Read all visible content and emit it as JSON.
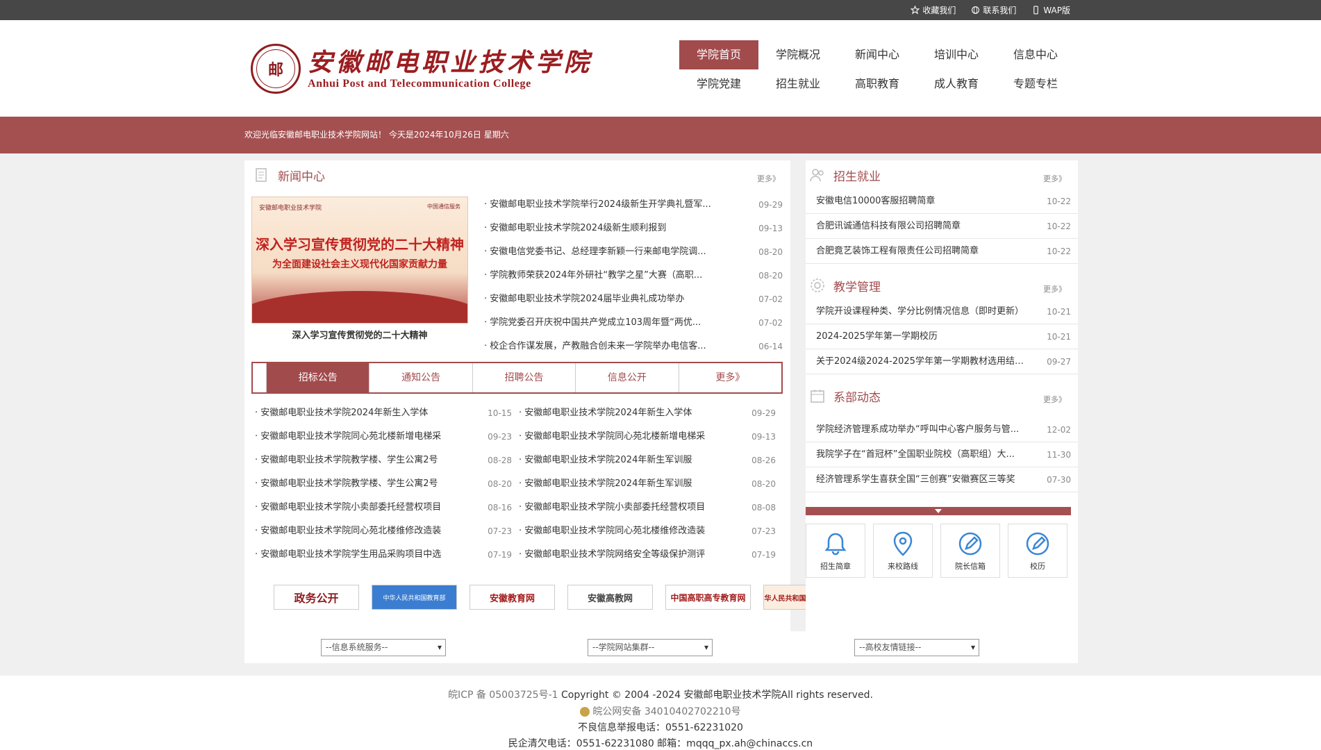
{
  "topbar": {
    "favorite": "收藏我们",
    "contact": "联系我们",
    "wap": "WAP版"
  },
  "header": {
    "logo_seal": "邮",
    "logo_cn": "安徽邮电职业技术学院",
    "logo_en": "Anhui Post and Telecommunication College"
  },
  "nav": {
    "row1": [
      "学院首页",
      "学院概况",
      "新闻中心",
      "培训中心",
      "信息中心"
    ],
    "row2": [
      "学院党建",
      "招生就业",
      "高职教育",
      "成人教育",
      "专题专栏"
    ]
  },
  "welcome": "欢迎光临安徽邮电职业技术学院网站！ 今天是2024年10月26日 星期六",
  "news": {
    "title": "新闻中心",
    "more": "更多》",
    "feature": {
      "img_top_left": "安徽邮电职业技术学院",
      "img_top_right": "中国通信服务",
      "img_title1": "深入学习宣传贯彻党的二十大精神",
      "img_title2": "为全面建设社会主义现代化国家贡献力量",
      "caption": "深入学习宣传贯彻党的二十大精神"
    },
    "items": [
      {
        "title": "· 安徽邮电职业技术学院举行2024级新生开学典礼暨军...",
        "date": "09-29"
      },
      {
        "title": "· 安徽邮电职业技术学院2024级新生顺利报到",
        "date": "09-13"
      },
      {
        "title": "· 安徽电信党委书记、总经理李新颖一行来邮电学院调...",
        "date": "08-20"
      },
      {
        "title": "· 学院教师荣获2024年外研社“教学之星”大赛（高职...",
        "date": "08-20"
      },
      {
        "title": "· 安徽邮电职业技术学院2024届毕业典礼成功举办",
        "date": "07-02"
      },
      {
        "title": "· 学院党委召开庆祝中国共产党成立103周年暨“两优...",
        "date": "07-02"
      },
      {
        "title": "· 校企合作谋发展，产教融合创未来一学院举办电信客...",
        "date": "06-14"
      }
    ]
  },
  "tabs": [
    "招标公告",
    "通知公告",
    "招聘公告",
    "信息公开",
    "更多》"
  ],
  "notices": {
    "left": [
      {
        "title": "· 安徽邮电职业技术学院2024年新生入学体",
        "date": "10-15"
      },
      {
        "title": "· 安徽邮电职业技术学院同心苑北楼新增电梯采",
        "date": "09-23"
      },
      {
        "title": "· 安徽邮电职业技术学院教学楼、学生公寓2号",
        "date": "08-28"
      },
      {
        "title": "· 安徽邮电职业技术学院教学楼、学生公寓2号",
        "date": "08-20"
      },
      {
        "title": "· 安徽邮电职业技术学院小卖部委托经营权项目",
        "date": "08-16"
      },
      {
        "title": "· 安徽邮电职业技术学院同心苑北楼维修改造装",
        "date": "07-23"
      },
      {
        "title": "· 安徽邮电职业技术学院学生用品采购项目中选",
        "date": "07-19"
      }
    ],
    "right": [
      {
        "title": "· 安徽邮电职业技术学院2024年新生入学体",
        "date": "09-29"
      },
      {
        "title": "· 安徽邮电职业技术学院同心苑北楼新增电梯采",
        "date": "09-13"
      },
      {
        "title": "· 安徽邮电职业技术学院2024年新生军训服",
        "date": "08-26"
      },
      {
        "title": "· 安徽邮电职业技术学院2024年新生军训服",
        "date": "08-20"
      },
      {
        "title": "· 安徽邮电职业技术学院小卖部委托经营权项目",
        "date": "08-08"
      },
      {
        "title": "· 安徽邮电职业技术学院同心苑北楼维修改造装",
        "date": "07-23"
      },
      {
        "title": "· 安徽邮电职业技术学院网络安全等级保护测评",
        "date": "07-19"
      }
    ]
  },
  "partners": [
    "政务公开",
    "中华人民共和国教育部",
    "安徽教育网",
    "安徽高教网",
    "中国高职高专教育网",
    "中华人民共和国工业和信息化部"
  ],
  "recruit": {
    "title": "招生就业",
    "more": "更多》",
    "items": [
      {
        "title": "安徽电信10000客服招聘简章",
        "date": "10-22"
      },
      {
        "title": "合肥讯诚通信科技有限公司招聘简章",
        "date": "10-22"
      },
      {
        "title": "合肥竟艺装饰工程有限责任公司招聘简章",
        "date": "10-22"
      }
    ]
  },
  "teaching": {
    "title": "教学管理",
    "more": "更多》",
    "items": [
      {
        "title": "学院开设课程种类、学分比例情况信息（即时更新）",
        "date": "10-21"
      },
      {
        "title": "2024-2025学年第一学期校历",
        "date": "10-21"
      },
      {
        "title": "关于2024级2024-2025学年第一学期教材选用结果...",
        "date": "09-27"
      }
    ]
  },
  "dept": {
    "title": "系部动态",
    "more": "更多》",
    "items": [
      {
        "title": "学院经济管理系成功举办“呼叫中心客户服务与管...",
        "date": "12-02"
      },
      {
        "title": "我院学子在“首冠杯”全国职业院校（高职组）大...",
        "date": "11-30"
      },
      {
        "title": "经济管理系学生喜获全国“三创赛”安徽赛区三等奖",
        "date": "07-30"
      }
    ]
  },
  "quick": [
    "招生简章",
    "来校路线",
    "院长信箱",
    "校历"
  ],
  "selects": [
    "--信息系统服务--",
    "--学院网站集群--",
    "--高校友情链接--"
  ],
  "footer": {
    "icp": "皖ICP 备 05003725号-1",
    "copyright": "Copyright © 2004 -2024 安徽邮电职业技术学院All rights reserved.",
    "police": "皖公网安备 34010402702210号",
    "report": "不良信息举报电话：0551-62231020",
    "complaint": "民企清欠电话：0551-62231080 邮箱：mqqq_px.ah@chinaccs.cn"
  },
  "colors": {
    "accent": "#a24b4c",
    "topbar": "#474747"
  }
}
